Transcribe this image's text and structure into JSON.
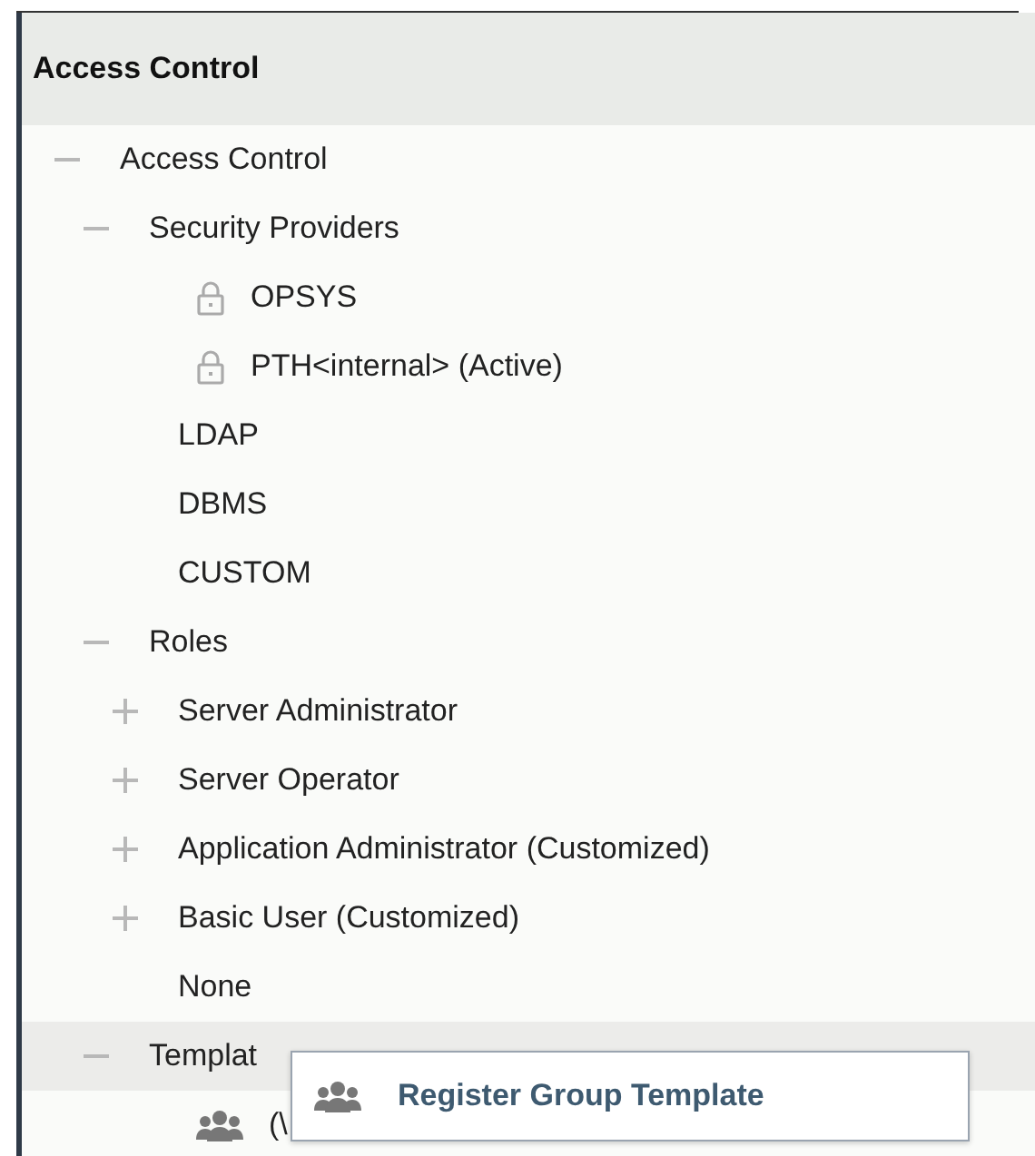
{
  "panel": {
    "title": "Access Control"
  },
  "tree": [
    {
      "label": "Access Control",
      "expanded": true,
      "selected": false,
      "children": [
        {
          "label": "Security Providers",
          "expanded": true,
          "selected": false,
          "children": [
            {
              "label": "OPSYS",
              "kind": "lock",
              "selected": false
            },
            {
              "label": "PTH<internal> (Active)",
              "kind": "lock",
              "selected": false
            },
            {
              "label": "LDAP",
              "selected": false
            },
            {
              "label": "DBMS",
              "selected": false
            },
            {
              "label": "CUSTOM",
              "selected": false
            }
          ]
        },
        {
          "label": "Roles",
          "expanded": true,
          "selected": false,
          "children": [
            {
              "label": "Server Administrator",
              "expanded": false,
              "selected": false
            },
            {
              "label": "Server Operator",
              "expanded": false,
              "selected": false
            },
            {
              "label": "Application Administrator (Customized)",
              "expanded": false,
              "selected": false
            },
            {
              "label": "Basic User (Customized)",
              "expanded": false,
              "selected": false
            },
            {
              "label": "None",
              "selected": false
            }
          ]
        },
        {
          "label": "Templat",
          "expanded": true,
          "selected": true,
          "context_menu": [
            {
              "label": "Register Group Template",
              "kind": "group"
            }
          ],
          "children": [
            {
              "label": "(\\",
              "kind": "group",
              "selected": false
            }
          ]
        }
      ]
    }
  ]
}
